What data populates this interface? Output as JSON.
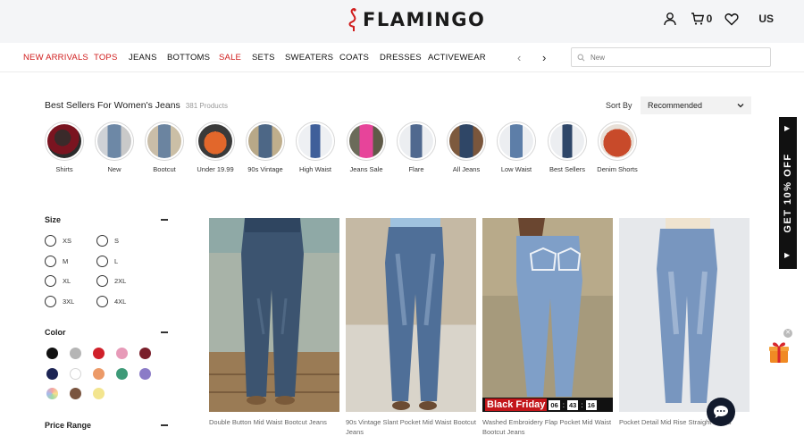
{
  "brand": {
    "logo_text": "FLAMINGO"
  },
  "header": {
    "cart_count": "0",
    "language": "US"
  },
  "nav": {
    "items": [
      {
        "label": "NEW ARRIVALS",
        "highlight": true
      },
      {
        "label": "TOPS",
        "highlight": true
      },
      {
        "label": "JEANS",
        "highlight": false
      },
      {
        "label": "BOTTOMS",
        "highlight": false
      },
      {
        "label": "SALE",
        "highlight": true
      },
      {
        "label": "SETS",
        "highlight": false
      },
      {
        "label": "SWEATERS",
        "highlight": false
      },
      {
        "label": "COATS",
        "highlight": false
      },
      {
        "label": "DRESSES",
        "highlight": false
      },
      {
        "label": "ACTIVEWEAR",
        "highlight": false
      }
    ],
    "prev_icon": "chevron-left-icon",
    "next_icon": "chevron-right-icon"
  },
  "search": {
    "placeholder": "New"
  },
  "listing": {
    "title": "Best Sellers For Women's Jeans",
    "count": "381 Products"
  },
  "sort": {
    "label": "Sort By",
    "selected": "Recommended"
  },
  "categories": [
    {
      "label": "Shirts"
    },
    {
      "label": "New"
    },
    {
      "label": "Bootcut"
    },
    {
      "label": "Under 19.99"
    },
    {
      "label": "90s Vintage"
    },
    {
      "label": "High Waist"
    },
    {
      "label": "Jeans Sale"
    },
    {
      "label": "Flare"
    },
    {
      "label": "All Jeans"
    },
    {
      "label": "Low Waist"
    },
    {
      "label": "Best Sellers"
    },
    {
      "label": "Denim Shorts"
    }
  ],
  "filters": {
    "size": {
      "title": "Size",
      "options": [
        "XS",
        "S",
        "M",
        "L",
        "XL",
        "2XL",
        "3XL",
        "4XL"
      ]
    },
    "color": {
      "title": "Color",
      "swatches": [
        "#111111",
        "#b5b5b5",
        "#d0202a",
        "#e79ab8",
        "#7a1f2b",
        "#1c2454",
        "#ffffff",
        "#ec9a68",
        "#3e9a78",
        "#8b7bc7",
        "multicolor",
        "#7a5540",
        "#f3e58f"
      ]
    },
    "price": {
      "title": "Price Range"
    }
  },
  "products": [
    {
      "name": "Double Button Mid Waist Bootcut Jeans"
    },
    {
      "name": "90s Vintage Slant Pocket Mid Waist Bootcut Jeans"
    },
    {
      "name": "Washed Embroidery Flap Pocket Mid Waist Bootcut Jeans",
      "banner": {
        "label": "Black Friday",
        "hours": "06",
        "minutes": "43",
        "seconds": "16"
      }
    },
    {
      "name": "Pocket Detail Mid Rise Straight Jeans"
    }
  ],
  "promo": {
    "label": "GET 10% OFF"
  },
  "colors": {
    "accent": "#d01c1c",
    "promo_bg": "#111111",
    "chat_bg": "#121a2c"
  }
}
